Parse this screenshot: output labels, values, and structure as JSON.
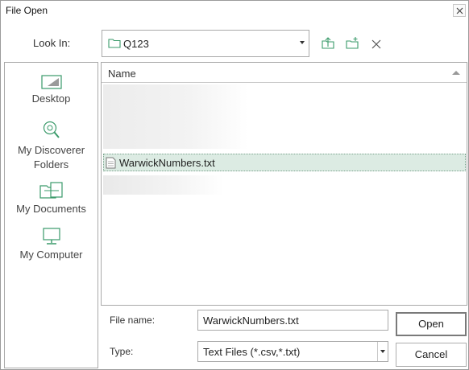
{
  "window": {
    "title": "File Open",
    "close_icon": "close-icon"
  },
  "lookin": {
    "label": "Look In:",
    "value": "Q123",
    "folder_icon": "folder-icon"
  },
  "toolbar": [
    {
      "name": "up-folder-icon"
    },
    {
      "name": "new-folder-icon"
    },
    {
      "name": "delete-icon"
    }
  ],
  "places": [
    {
      "label": "Desktop",
      "icon": "desktop-icon"
    },
    {
      "label": "My Discoverer Folders",
      "icon": "discoverer-icon"
    },
    {
      "label": "My Documents",
      "icon": "documents-folder-icon"
    },
    {
      "label": "My Computer",
      "icon": "computer-icon"
    }
  ],
  "filelist": {
    "column_name": "Name",
    "files": [
      {
        "name": "WarwickNumbers.txt",
        "icon": "text-file-icon",
        "selected": true
      }
    ]
  },
  "form": {
    "filename_label": "File name:",
    "filename_value": "WarwickNumbers.txt",
    "type_label": "Type:",
    "type_value": "Text Files (*.csv,*.txt)"
  },
  "buttons": {
    "open": "Open",
    "cancel": "Cancel"
  },
  "colors": {
    "accent": "#3a9a6a",
    "selection": "#dcebe3"
  }
}
